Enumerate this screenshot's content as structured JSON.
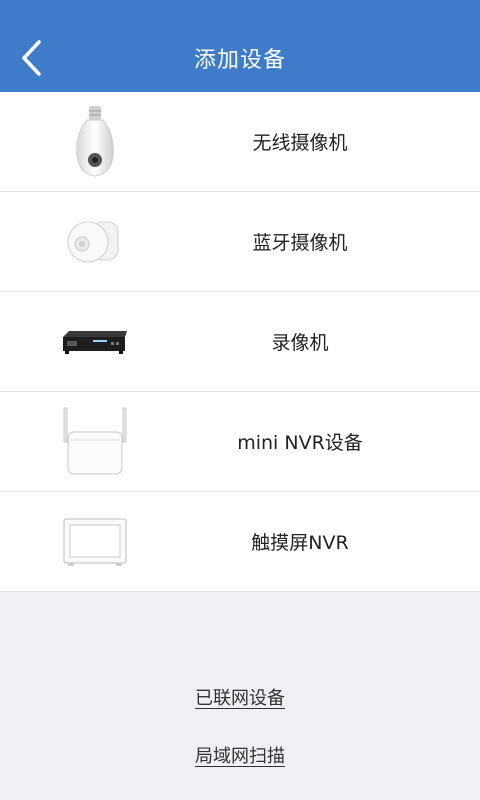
{
  "header": {
    "title": "添加设备",
    "back_icon": "chevron-left-icon"
  },
  "devices": [
    {
      "label": "无线摄像机",
      "icon": "bulb-camera-icon"
    },
    {
      "label": "蓝牙摄像机",
      "icon": "bluetooth-camera-icon"
    },
    {
      "label": "录像机",
      "icon": "dvr-recorder-icon"
    },
    {
      "label": "mini NVR设备",
      "icon": "mini-nvr-icon"
    },
    {
      "label": "触摸屏NVR",
      "icon": "touchscreen-nvr-icon"
    }
  ],
  "links": {
    "connected": "已联网设备",
    "lan_scan": "局域网扫描"
  },
  "colors": {
    "header": "#3e7bc9",
    "background": "#efeff4"
  }
}
